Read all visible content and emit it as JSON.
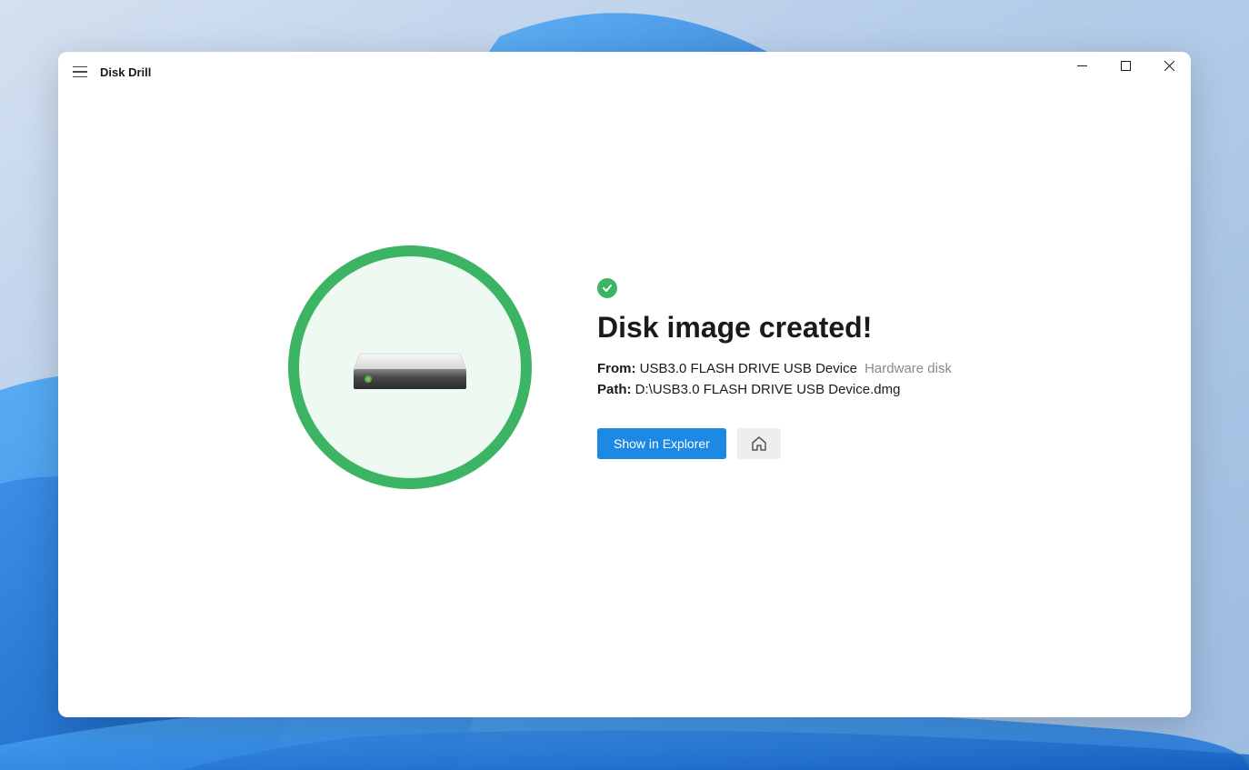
{
  "app_title": "Disk Drill",
  "main": {
    "heading": "Disk image created!",
    "from_label": "From:",
    "from_device": "USB3.0 FLASH DRIVE USB Device",
    "from_type": "Hardware disk",
    "path_label": "Path:",
    "path_value": "D:\\USB3.0 FLASH DRIVE USB Device.dmg",
    "show_button": "Show in Explorer"
  }
}
